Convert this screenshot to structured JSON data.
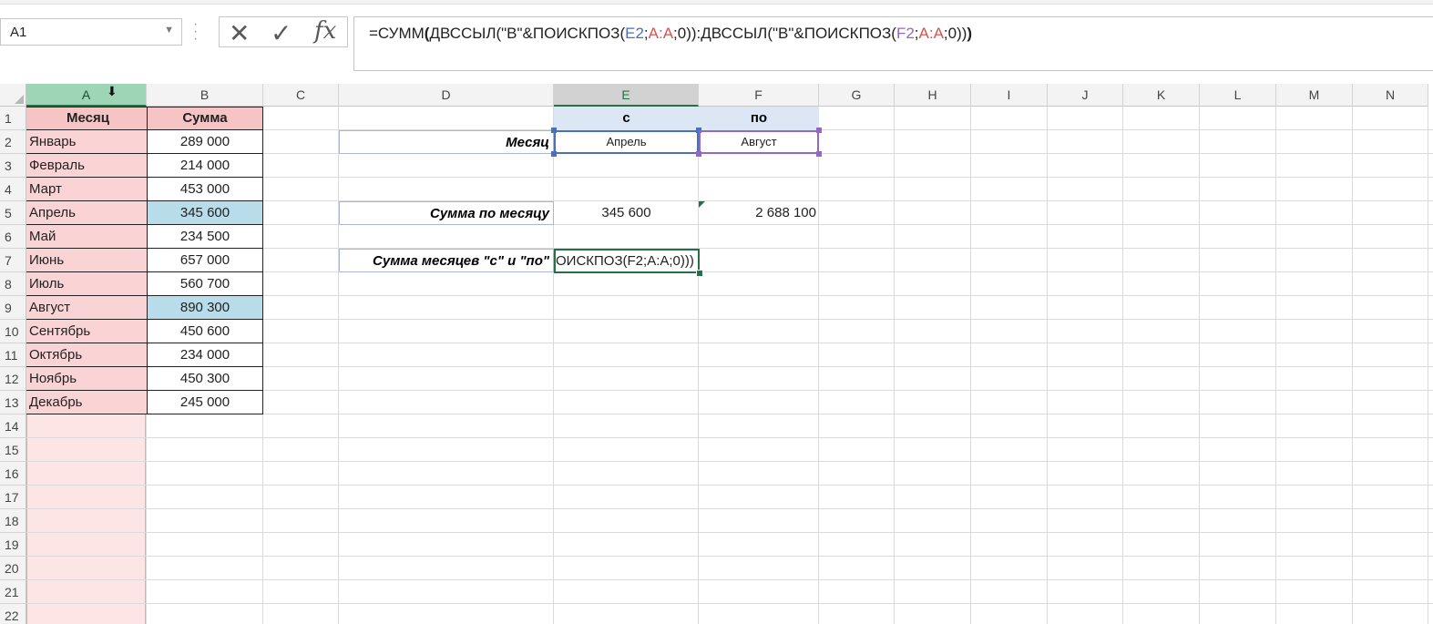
{
  "formula_bar": {
    "name_box": "A1",
    "formula_prefix": "=СУММ",
    "formula_part1": "ДВССЫЛ(\"B\"&ПОИСКПОЗ(",
    "ref_e2": "E2",
    "sep1": ";",
    "ref_aa1": "A:A",
    "tail1": ";0)):ДВССЫЛ(\"B\"&ПОИСКПОЗ(",
    "ref_f2": "F2",
    "sep2": ";",
    "ref_aa2": "A:A",
    "tail2": ";0))",
    "close_paren": ")"
  },
  "columns": [
    "A",
    "B",
    "C",
    "D",
    "E",
    "F",
    "G",
    "H",
    "I",
    "J",
    "K",
    "L",
    "M",
    "N"
  ],
  "rows": [
    "1",
    "2",
    "3",
    "4",
    "5",
    "6",
    "7",
    "8",
    "9",
    "10",
    "11",
    "12",
    "13",
    "14",
    "15",
    "16",
    "17",
    "18",
    "19",
    "20",
    "21",
    "22"
  ],
  "table": {
    "header_month": "Месяц",
    "header_sum": "Сумма",
    "months": [
      "Январь",
      "Февраль",
      "Март",
      "Апрель",
      "Май",
      "Июнь",
      "Июль",
      "Август",
      "Сентябрь",
      "Октябрь",
      "Ноябрь",
      "Декабрь"
    ],
    "sums": [
      "289 000",
      "214 000",
      "453 000",
      "345 600",
      "234 500",
      "657 000",
      "560 700",
      "890 300",
      "450 600",
      "234 000",
      "450 300",
      "245 000"
    ]
  },
  "params": {
    "from_header": "с",
    "to_header": "по",
    "month_label": "Месяц",
    "from_value": "Апрель",
    "to_value": "Август",
    "sum_label": "Сумма по месяцу",
    "sum_from": "345 600",
    "sum_to": "2 688 100",
    "range_label": "Сумма месяцев \"с\" и \"по\"",
    "edit_text": "ОИСКПОЗ(F2;A:A;0)))"
  },
  "colors": {
    "accent": "#217346",
    "ref_e": "#4a6fbf",
    "ref_f": "#9467c4",
    "ref_a": "#d9534f",
    "highlight": "#b8dcea"
  }
}
